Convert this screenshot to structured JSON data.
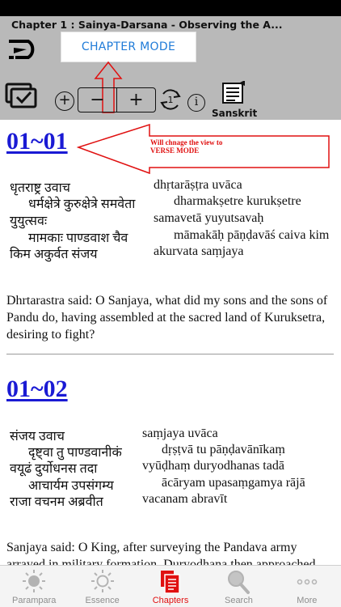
{
  "header": {
    "chapter_title": "Chapter 1 : Sainya-Darsana - Observing the A...",
    "mode_button_label": "CHAPTER MODE",
    "sanskrit_label": "Sanskrit",
    "repeat_count": "1"
  },
  "annotation": {
    "text_line1": "Will chnage the view to",
    "text_line2": "VERSE MODE",
    "color": "#e01010"
  },
  "verses": [
    {
      "number": "01~01",
      "devanagari": [
        "धृतराष्ट्र उवाच",
        "धर्मक्षेत्रे कुरुक्षेत्रे समवेता",
        "युयुत्सवः",
        "मामकाः पाण्डवाश चैव",
        "किम अकुर्वत संजय"
      ],
      "transliteration": [
        "dhṛtarāṣṭra uvāca",
        "dharmakṣetre kurukṣetre",
        "samavetā yuyutsavaḥ",
        "māmakāḥ pāṇḍavāś caiva kim",
        "akurvata saṃjaya"
      ],
      "translation": "Dhrtarastra said: O Sanjaya, what did my sons and the sons of Pandu do, having assembled at the sacred land of Kuruksetra, desiring to fight?"
    },
    {
      "number": "01~02",
      "devanagari": [
        "संजय उवाच",
        "दृष्ट्वा तु पाण्डवानीकं",
        "वयूढं दुर्योधनस तदा",
        "आचार्यम उपसंगम्य",
        "राजा वचनम अब्रवीत"
      ],
      "transliteration": [
        "saṃjaya uvāca",
        "dṛṣṭvā tu pāṇḍavānīkaṃ",
        "vyūḍhaṃ duryodhanas tadā",
        "ācāryam upasaṃgamya rājā",
        "vacanam abravīt"
      ],
      "translation": "Sanjaya said: O King, after surveying the Pandava army arrayed in military formation, Duryodhana then approached"
    }
  ],
  "tabs": [
    {
      "label": "Parampara",
      "icon": "sun-icon",
      "active": false
    },
    {
      "label": "Essence",
      "icon": "sun-outline-icon",
      "active": false
    },
    {
      "label": "Chapters",
      "icon": "documents-icon",
      "active": true
    },
    {
      "label": "Search",
      "icon": "magnifier-icon",
      "active": false
    },
    {
      "label": "More",
      "icon": "more-dots-icon",
      "active": false
    }
  ],
  "colors": {
    "accent_red": "#e01010",
    "verse_link": "#1a1ad4",
    "button_text": "#1f7bd8",
    "toolbar_bg": "#b9b9b9"
  }
}
